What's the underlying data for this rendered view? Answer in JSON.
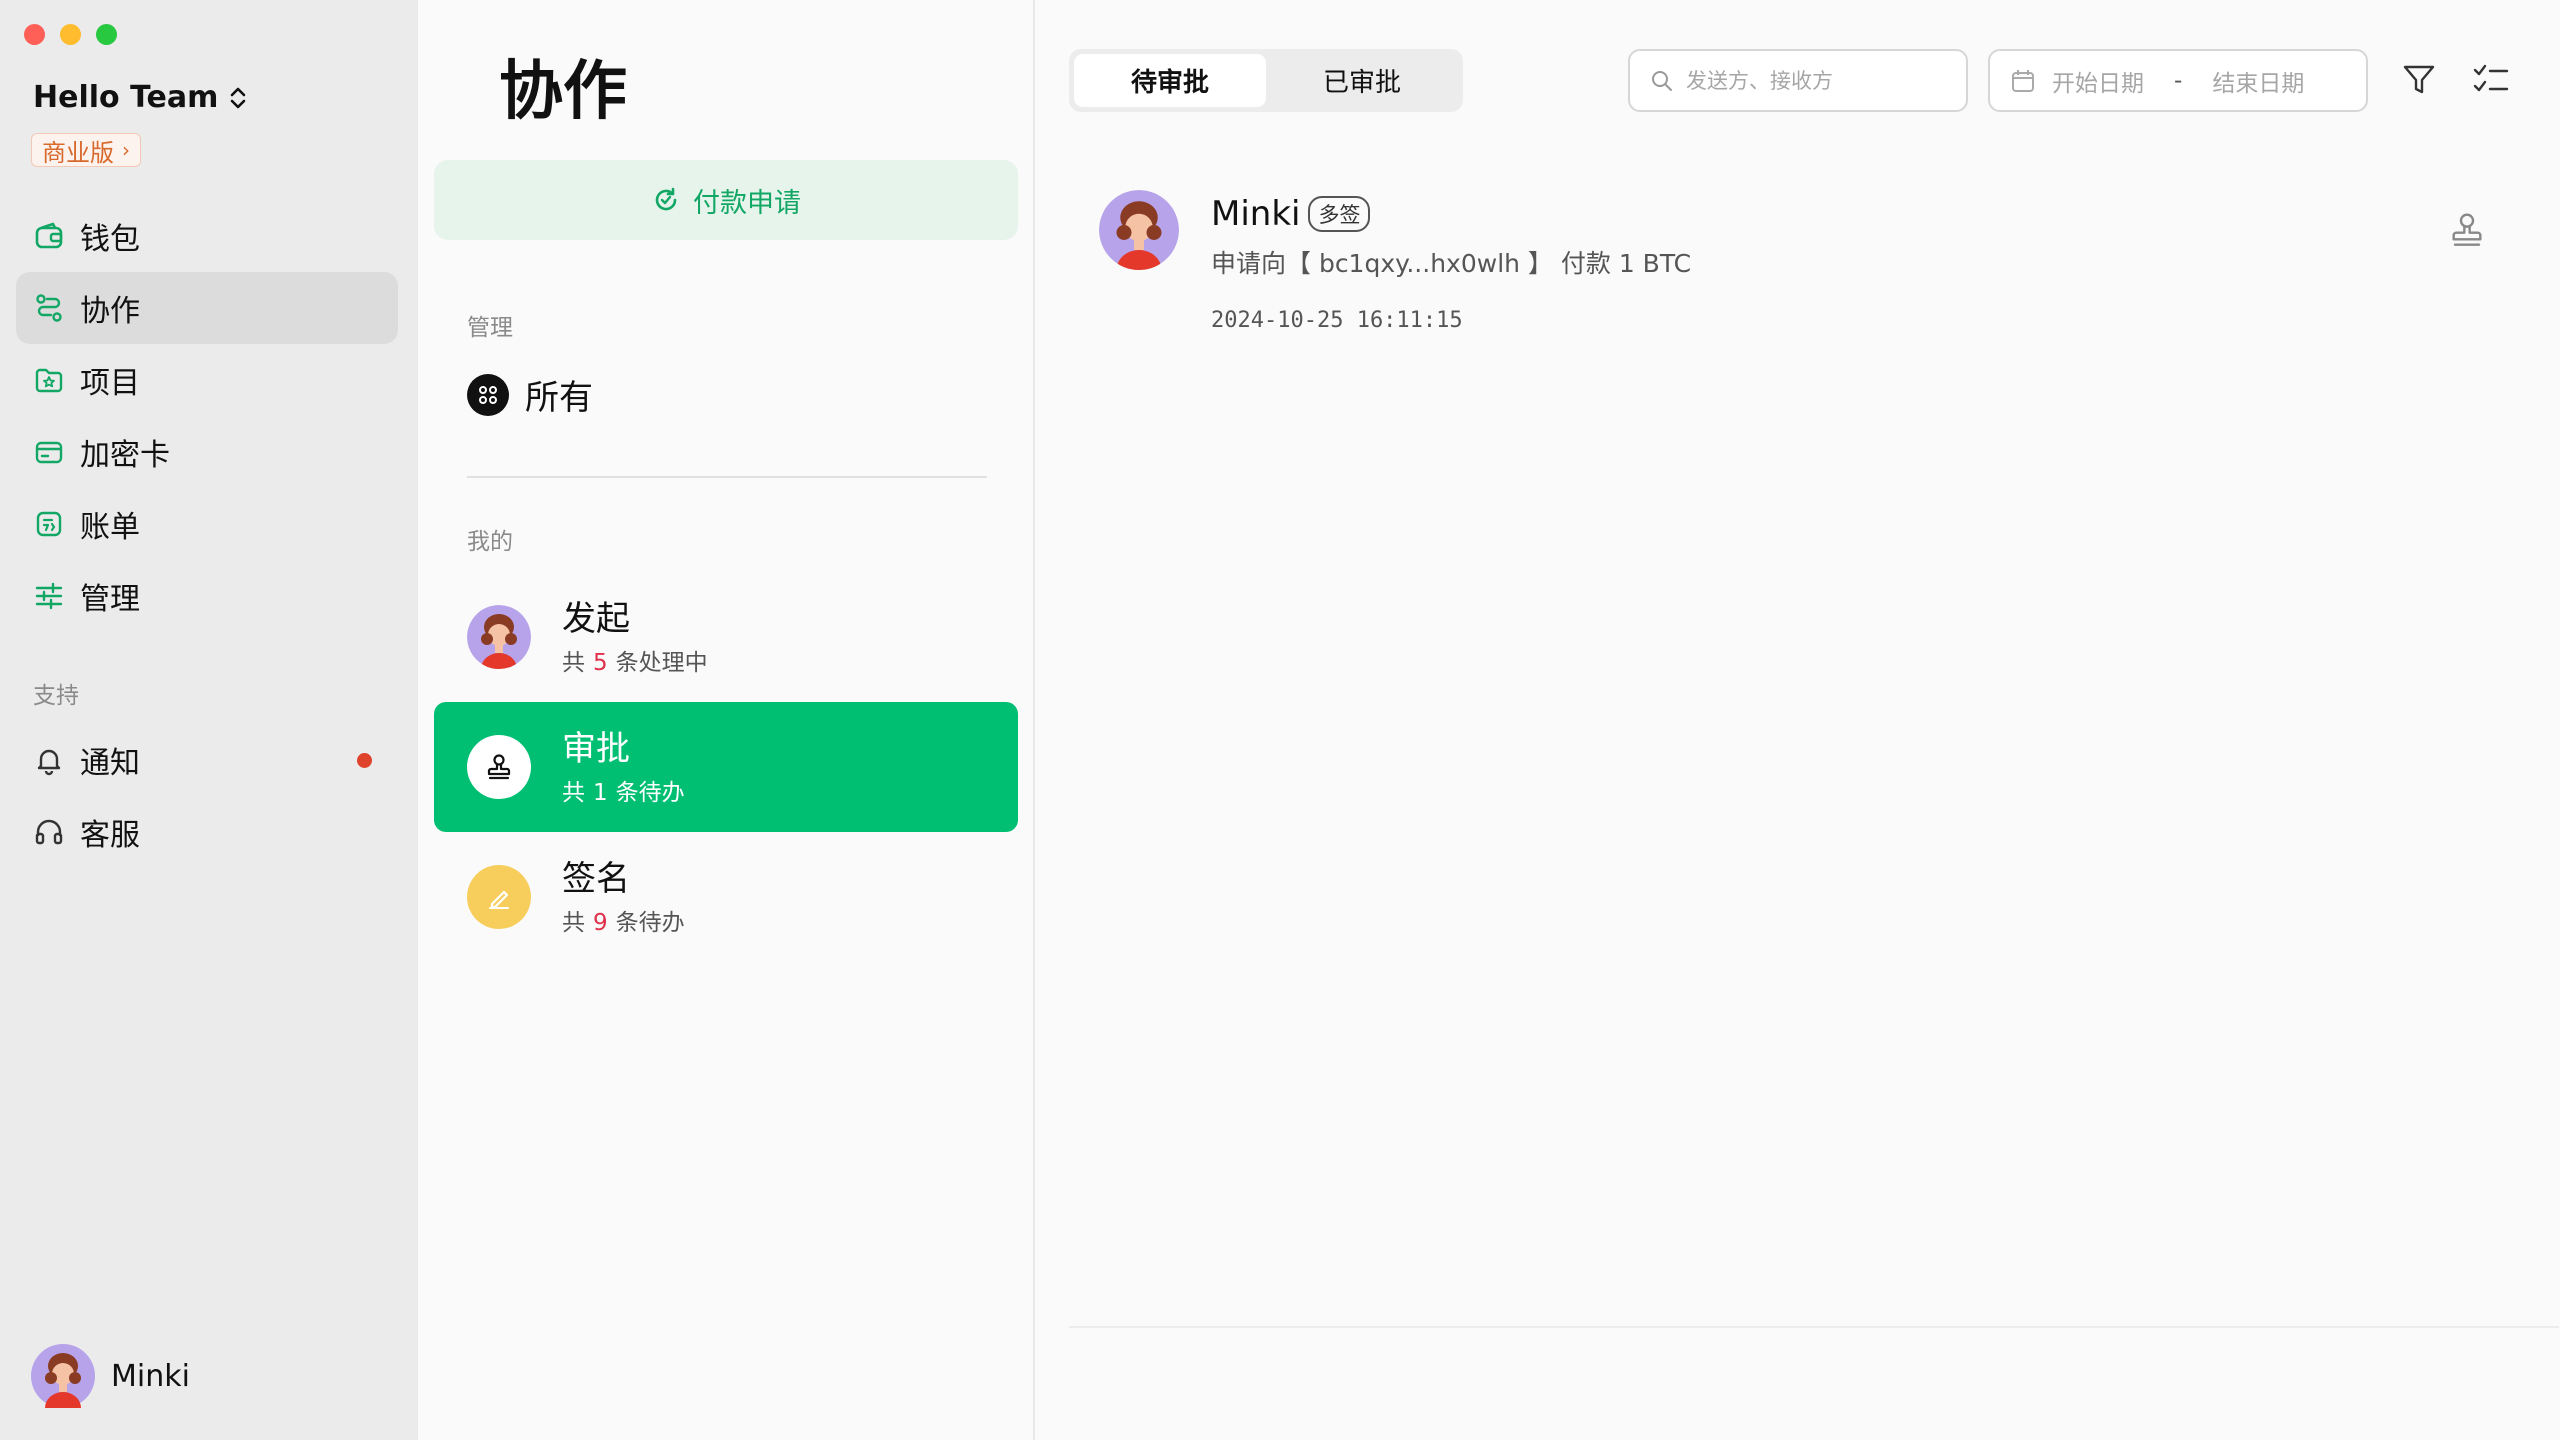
{
  "sidebar": {
    "team_name": "Hello Team",
    "edition": "商业版",
    "nav": [
      {
        "label": "钱包",
        "icon": "wallet-icon"
      },
      {
        "label": "协作",
        "icon": "collab-icon",
        "active": true
      },
      {
        "label": "项目",
        "icon": "project-icon"
      },
      {
        "label": "加密卡",
        "icon": "card-icon"
      },
      {
        "label": "账单",
        "icon": "bill-icon"
      },
      {
        "label": "管理",
        "icon": "manage-icon"
      }
    ],
    "support_label": "支持",
    "support": [
      {
        "label": "通知",
        "icon": "bell-icon",
        "dot": true
      },
      {
        "label": "客服",
        "icon": "headset-icon"
      }
    ],
    "user_name": "Minki"
  },
  "middle": {
    "title": "协作",
    "pay_button": "付款申请",
    "manage_label": "管理",
    "all_label": "所有",
    "mine_label": "我的",
    "cards": [
      {
        "title": "发起",
        "prefix": "共",
        "count": "5",
        "suffix": "条处理中",
        "active": false
      },
      {
        "title": "审批",
        "prefix": "共",
        "count": "1",
        "suffix": "条待办",
        "active": true
      },
      {
        "title": "签名",
        "prefix": "共",
        "count": "9",
        "suffix": "条待办",
        "active": false
      }
    ]
  },
  "content": {
    "tabs": [
      "待审批",
      "已审批"
    ],
    "active_tab": 0,
    "search_placeholder": "发送方、接收方",
    "date_start": "开始日期",
    "date_sep": "-",
    "date_end": "结束日期",
    "requests": [
      {
        "name": "Minki",
        "tag": "多签",
        "description": "申请向【 bc1qxy...hx0wlh 】 付款 1 BTC",
        "time": "2024-10-25 16:11:15"
      }
    ]
  },
  "colors": {
    "accent": "#00bf72",
    "accent_light": "#e6f4ec",
    "badge": "#d8692c",
    "count": "#e0304b",
    "dot": "#e0432b"
  }
}
